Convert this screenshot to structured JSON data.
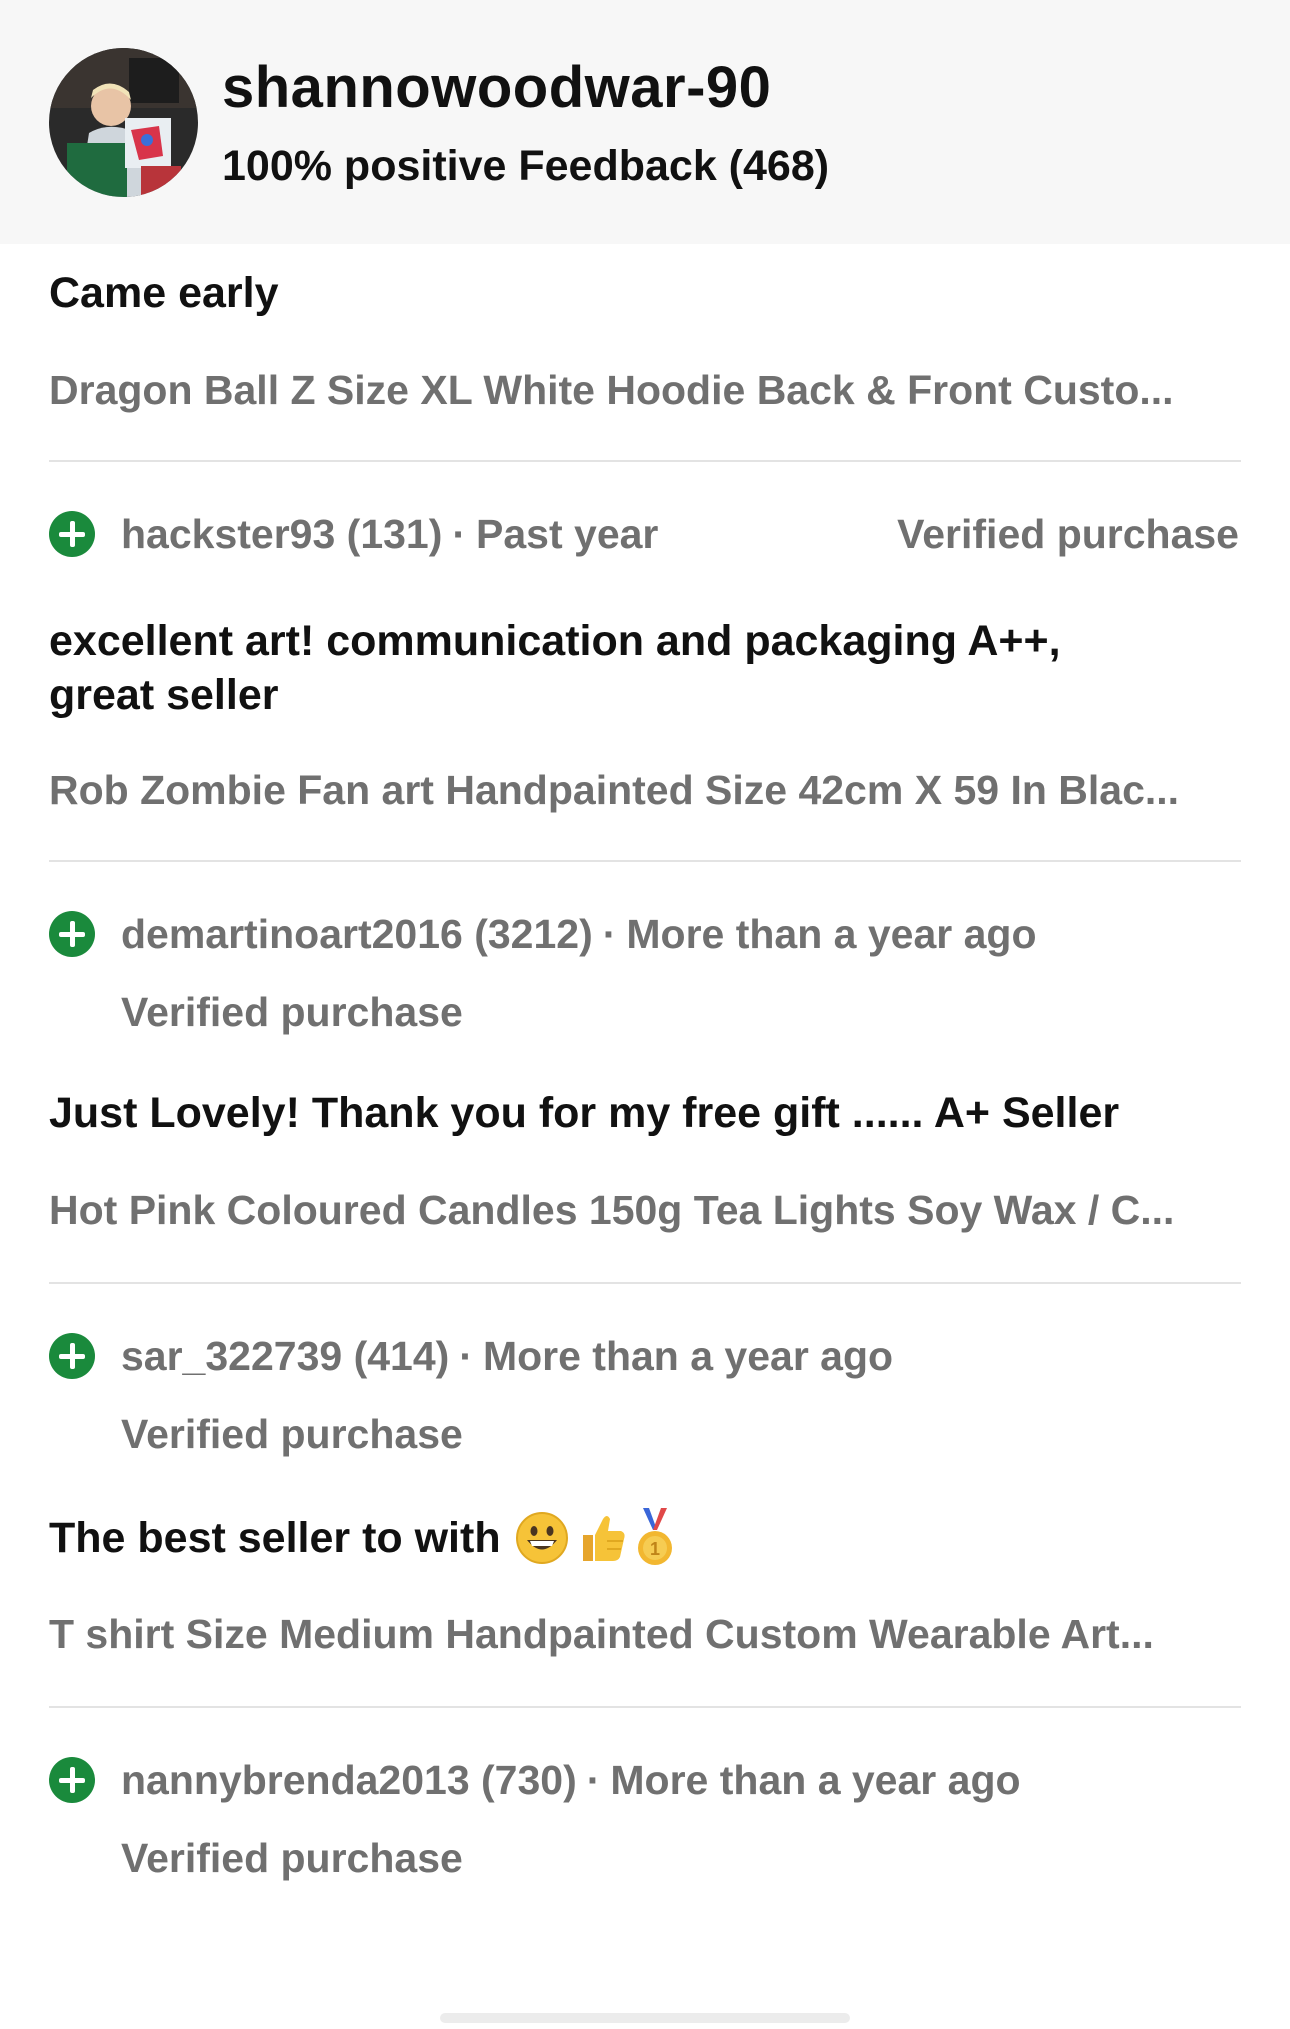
{
  "seller": {
    "name": "shannowoodwar-90",
    "feedback": "100% positive Feedback (468)",
    "avatar_icon": "avatar-photo"
  },
  "first_review": {
    "title": "Came early",
    "item": "Dragon Ball Z Size XL White Hoodie Back & Front Custo..."
  },
  "reviews": [
    {
      "user": "hackster93 (131)",
      "sep": "·",
      "time": "Past year",
      "verified": "Verified purchase",
      "title_line1": "excellent art! communication and packaging A++,",
      "title_line2": "great seller",
      "item": "Rob Zombie Fan art Handpainted Size 42cm X 59 In Blac..."
    },
    {
      "user": "demartinoart2016 (3212)",
      "sep": "·",
      "time": "More than a year ago",
      "verified": "Verified purchase",
      "title": "Just Lovely! Thank you for my free gift ...... A+ Seller",
      "item": "Hot Pink Coloured Candles 150g Tea Lights Soy Wax / C..."
    },
    {
      "user": "sar_322739 (414)",
      "sep": "·",
      "time": "More than a year ago",
      "verified": "Verified purchase",
      "title": "The best seller to with",
      "emojis": [
        "grinning-face-emoji",
        "thumbs-up-emoji",
        "first-place-medal-emoji"
      ],
      "item": "T shirt Size Medium Handpainted Custom Wearable Art..."
    },
    {
      "user": "nannybrenda2013 (730)",
      "sep": "·",
      "time": "More than a year ago",
      "verified": "Verified purchase"
    }
  ],
  "colors": {
    "positive": "#1a8a3c",
    "muted_text": "#707070",
    "header_bg": "#f7f7f7"
  }
}
